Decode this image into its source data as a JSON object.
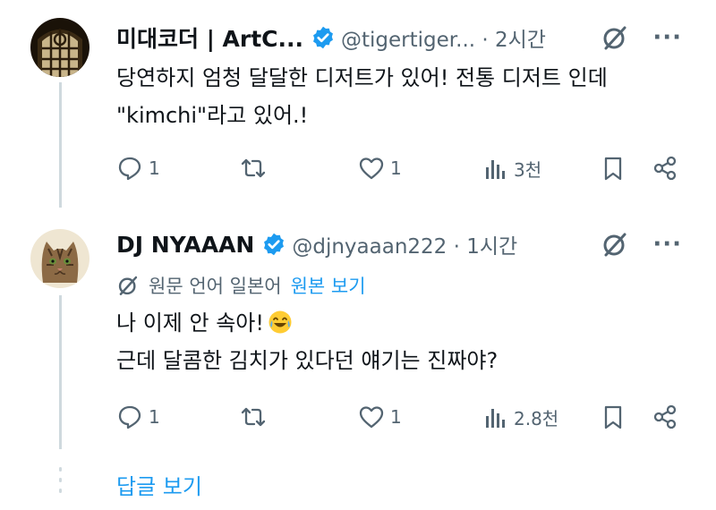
{
  "tweets": [
    {
      "name": "미대코더 | ArtC...",
      "handle": "@tigertiger... · 2시간",
      "lines": [
        "당연하지 엄청 달달한 디저트가 있어! 전통 디저트 인데",
        "\"kimchi\"라고 있어.!"
      ],
      "replies": "1",
      "likes": "1",
      "views": "3천",
      "avatar_icon": "stained-glass-window"
    },
    {
      "name": "DJ NYAAAN",
      "handle": "@djnyaaan222 · 1시간",
      "translate_text": "원문 언어 일본어",
      "translate_link": "원본 보기",
      "lines": [
        "나 이제 안 속아!",
        "근데 달콤한 김치가 있다던 얘기는 진짜야?"
      ],
      "replies": "1",
      "likes": "1",
      "views": "2.8천",
      "avatar_icon": "tabby-cat"
    }
  ],
  "show_replies": "답글 보기",
  "colors": {
    "accent": "#1d9bf0",
    "muted": "#536471",
    "text": "#0f1419",
    "line": "#cfd9de"
  }
}
